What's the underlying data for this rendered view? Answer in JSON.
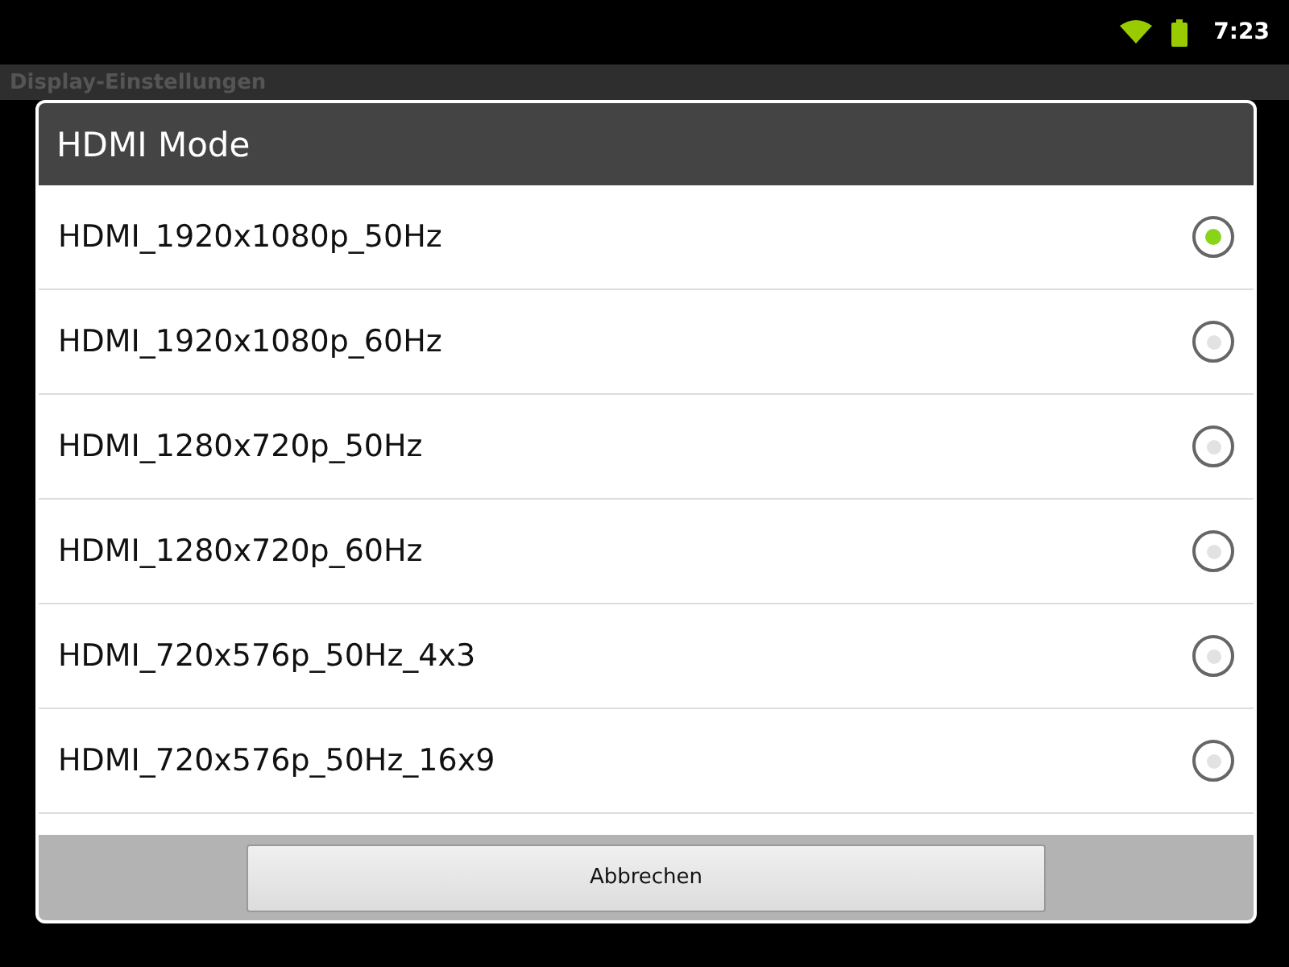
{
  "status_bar": {
    "time": "7:23"
  },
  "app_bar": {
    "title": "Display-Einstellungen"
  },
  "dialog": {
    "title": "HDMI Mode",
    "options": [
      {
        "label": "HDMI_1920x1080p_50Hz",
        "selected": true
      },
      {
        "label": "HDMI_1920x1080p_60Hz",
        "selected": false
      },
      {
        "label": "HDMI_1280x720p_50Hz",
        "selected": false
      },
      {
        "label": "HDMI_1280x720p_60Hz",
        "selected": false
      },
      {
        "label": "HDMI_720x576p_50Hz_4x3",
        "selected": false
      },
      {
        "label": "HDMI_720x576p_50Hz_16x9",
        "selected": false
      }
    ],
    "buttons": [
      "Abbrechen"
    ]
  }
}
